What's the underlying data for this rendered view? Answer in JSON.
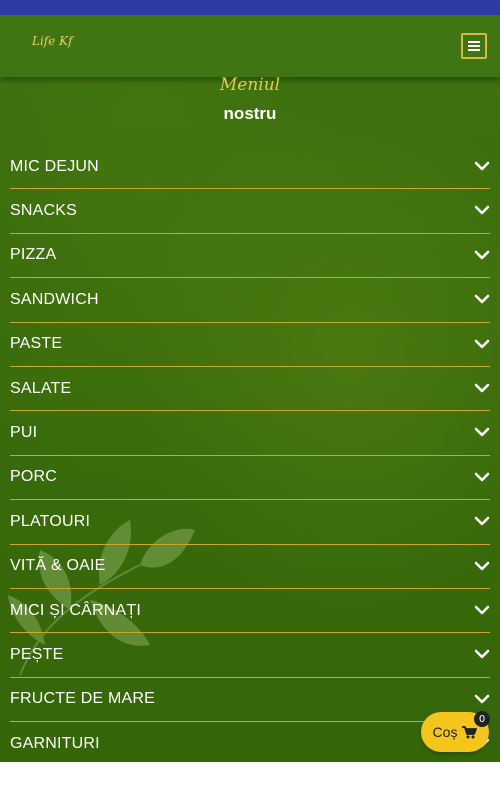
{
  "header": {
    "logo_text": "Life Kf",
    "menu_icon": "hamburger-icon"
  },
  "section": {
    "title_script": "Meniul",
    "title_main": "nostru"
  },
  "categories": [
    {
      "label": "MIC  DEJUN"
    },
    {
      "label": "SNACKS"
    },
    {
      "label": "PIZZA"
    },
    {
      "label": "SANDWICH"
    },
    {
      "label": "PASTE"
    },
    {
      "label": "SALATE"
    },
    {
      "label": "PUI"
    },
    {
      "label": "PORC"
    },
    {
      "label": "PLATOURI"
    },
    {
      "label": "VITĂ & OAIE"
    },
    {
      "label": "MICI ȘI CÂRNAȚI"
    },
    {
      "label": "PEȘTE"
    },
    {
      "label": "FRUCTE DE MARE"
    },
    {
      "label": "GARNITURI"
    }
  ],
  "cart": {
    "label": "Coș",
    "count": "0",
    "icon": "cart-icon"
  },
  "colors": {
    "status_bar": "#2f3aa8",
    "background_green": "#3a6d0c",
    "accent_gold": "#d8b838",
    "cart_yellow": "#f4c51a"
  }
}
